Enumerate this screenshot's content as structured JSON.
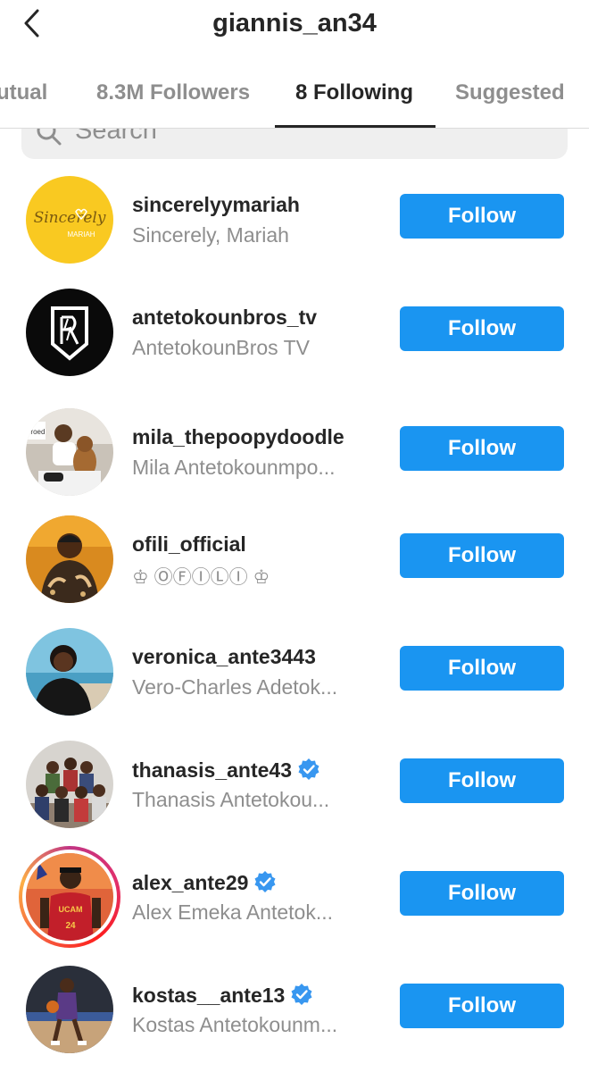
{
  "header": {
    "title": "giannis_an34"
  },
  "tabs": [
    {
      "label": "Mutual"
    },
    {
      "label": "8.3M Followers"
    },
    {
      "label": "8 Following"
    },
    {
      "label": "Suggested"
    }
  ],
  "search": {
    "placeholder": "Search"
  },
  "follow_label": "Follow",
  "accounts": [
    {
      "username": "sincerelyymariah",
      "name": "Sincerely, Mariah",
      "verified": false,
      "avatar_text": "Sincerely",
      "avatar_subtext": "MARIAH"
    },
    {
      "username": "antetokounbros_tv",
      "name": "AntetokounBros TV",
      "verified": false
    },
    {
      "username": "mila_thepoopydoodle",
      "name": "Mila Antetokounmpo...",
      "verified": false,
      "avatar_text": "Froed"
    },
    {
      "username": "ofili_official",
      "name": "♔ ⓄⒻⒾⓁⒾ ♔",
      "verified": false
    },
    {
      "username": "veronica_ante3443",
      "name": "Vero-Charles Adetok...",
      "verified": false
    },
    {
      "username": "thanasis_ante43",
      "name": "Thanasis Antetokou...",
      "verified": true
    },
    {
      "username": "alex_ante29",
      "name": "Alex Emeka Antetok...",
      "verified": true,
      "avatar_text": "UCAM",
      "avatar_subtext": "24"
    },
    {
      "username": "kostas__ante13",
      "name": "Kostas Antetokounm...",
      "verified": true
    }
  ],
  "colors": {
    "follow_button": "#1a95f1",
    "verified": "#3897f0",
    "muted_text": "#8e8e8e"
  }
}
